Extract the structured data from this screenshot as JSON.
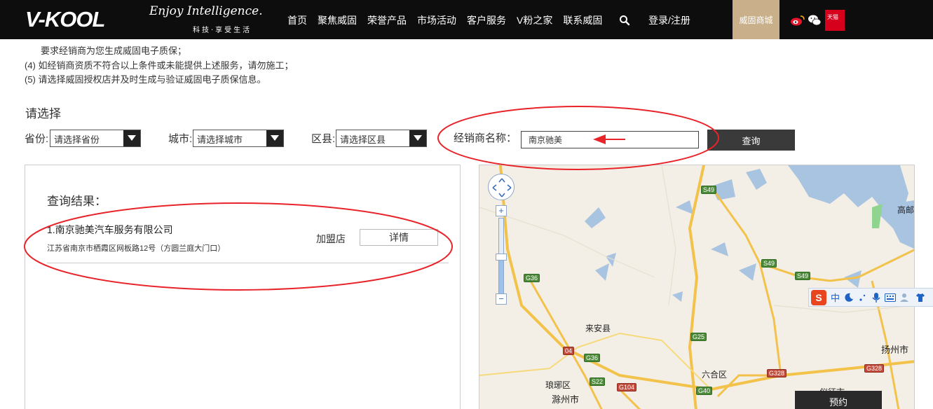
{
  "header": {
    "logo": "V-KOOL",
    "slogan": "Enjoy Intelligence.",
    "slogan_sub": "科技·享受生活",
    "nav": [
      "首页",
      "聚焦威固",
      "荣誉产品",
      "市场活动",
      "客户服务",
      "V粉之家",
      "联系威固"
    ],
    "login": "登录/注册",
    "mall": "威固商城",
    "icons": [
      "search-icon",
      "weibo-icon",
      "wechat-icon",
      "tmall-icon"
    ],
    "tmall_text": "天猫"
  },
  "info": {
    "line1": "要求经销商为您生成威固电子质保；",
    "line2": "(4) 如经销商资质不符合以上条件或未能提供上述服务，请勿施工；",
    "line3": "(5) 请选择威固授权店并及时生成与验证威固电子质保信息。"
  },
  "filter": {
    "title": "请选择",
    "province_label": "省份:",
    "province_value": "请选择省份",
    "city_label": "城市:",
    "city_value": "请选择城市",
    "district_label": "区县:",
    "district_value": "请选择区县",
    "dealer_label": "经销商名称：",
    "dealer_value": "南京驰美",
    "query": "查询"
  },
  "results": {
    "title": "查询结果：",
    "items": [
      {
        "name": "1.南京驰美汽车服务有限公司",
        "address": "江苏省南京市栖霞区网板路12号（方圆兰庭大门口）",
        "type": "加盟店",
        "detail": "详情"
      }
    ]
  },
  "map": {
    "labels": [
      "高邮",
      "来安县",
      "扬州市",
      "六合区",
      "琅琊区",
      "滁州市",
      "仪征市"
    ],
    "shields": [
      "S49",
      "S49",
      "S49",
      "G36",
      "G36",
      "G25",
      "S22",
      "G104",
      "G40",
      "G328",
      "G328",
      "04"
    ],
    "book": "预约"
  },
  "ime": {
    "mode": "中"
  },
  "colors": {
    "header_bg": "#0d0d0d",
    "mall_bg": "#c9b08a",
    "annotation_red": "#e8232a",
    "button_dark": "#3a3a3a"
  }
}
